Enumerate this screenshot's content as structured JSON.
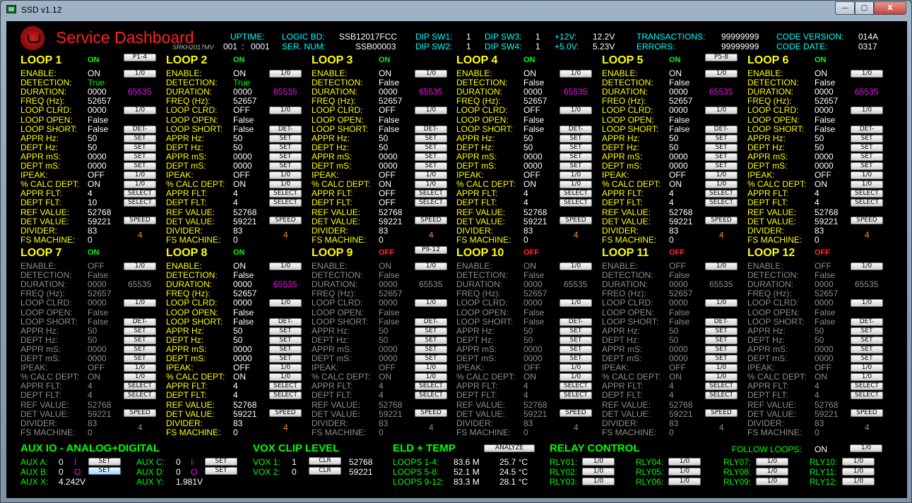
{
  "window": {
    "title": "SSD v1.12",
    "min_glyph": "—",
    "max_glyph": "□",
    "close_glyph": "X"
  },
  "header": {
    "title": "Service Dashboard",
    "subtitle": "SRKH2017MV",
    "uptime_label": "UPTIME:",
    "uptime_day": "001",
    "uptime_sep": ":",
    "uptime_time": "0001",
    "logic_bd_label": "LOGIC BD:",
    "logic_bd": "SSB12017FCC",
    "ser_num_label": "SER. NUM:",
    "ser_num": "SSB00003",
    "dip_sw1_label": "DIP SW1:",
    "dip_sw1": "1",
    "dip_sw2_label": "DIP SW2:",
    "dip_sw2": "1",
    "dip_sw3_label": "DIP SW3:",
    "dip_sw3": "1",
    "dip_sw4_label": "DIP SW4:",
    "dip_sw4": "1",
    "v12_label": "+12V:",
    "v12": "12.2V",
    "v5_label": "+5.0V:",
    "v5": "5.23V",
    "transactions_label": "TRANSACTIONS:",
    "transactions": "99999999",
    "errors_label": "ERRORS:",
    "errors": "99999999",
    "code_version_label": "CODE VERSION:",
    "code_version": "014A",
    "code_date_label": "CODE DATE:",
    "code_date": "0317"
  },
  "row_labels": [
    "ENABLE:",
    "DETECTION:",
    "DURATION:",
    "FREQ (Hz):",
    "LOOP CLRD:",
    "LOOP OPEN:",
    "LOOP SHORT:",
    "APPR Hz:",
    "DEPT Hz:",
    "APPR mS:",
    "DEPT mS:",
    "IPEAK:",
    "% CALC DEPT:",
    "APPR FLT:",
    "DEPT FLT:",
    "REF VALUE:",
    "DET VALUE:",
    "DIVIDER:",
    "FS MACHINE:"
  ],
  "button_labels": {
    "toggle": "1/0",
    "det": "DET-",
    "set": "SET",
    "select": "SELECT",
    "speed": "SPEED"
  },
  "loops": [
    {
      "name": "LOOP 1",
      "status": "ON",
      "active": true,
      "group_button": "P1-4",
      "freq_label": "FREQ (Hz):",
      "enable": "ON",
      "detection": "True",
      "duration": "0000",
      "duration_max": "65535",
      "freq": "52657",
      "loop_clrd": "0000",
      "loop_open": "False",
      "loop_short": "False",
      "appr_hz": "50",
      "dept_hz": "50",
      "appr_ms": "0000",
      "dept_ms": "0000",
      "ipeak": "OFF",
      "calc_dept": "ON",
      "appr_flt": "4",
      "dept_flt": "10",
      "ref_value": "52768",
      "det_value": "59221",
      "divider": "83",
      "fs_machine": "0",
      "speed_value": "4"
    },
    {
      "name": "LOOP 2",
      "status": "ON",
      "active": true,
      "group_button": "",
      "freq_label": "FREQ (Hz):",
      "enable": "ON",
      "detection": "True",
      "duration": "0000",
      "duration_max": "65535",
      "freq": "52657",
      "loop_clrd": "OFF",
      "loop_open": "False",
      "loop_short": "False",
      "appr_hz": "50",
      "dept_hz": "50",
      "appr_ms": "0000",
      "dept_ms": "0000",
      "ipeak": "OFF",
      "calc_dept": "ON",
      "appr_flt": "4",
      "dept_flt": "4",
      "ref_value": "52768",
      "det_value": "59221",
      "divider": "83",
      "fs_machine": "0",
      "speed_value": "4"
    },
    {
      "name": "LOOP 3",
      "status": "ON",
      "active": true,
      "group_button": "",
      "freq_label": "FREQ (Hz):",
      "enable": "ON",
      "detection": "False",
      "duration": "0000",
      "duration_max": "65535",
      "freq": "52657",
      "loop_clrd": "OFF",
      "loop_open": "False",
      "loop_short": "False",
      "appr_hz": "50",
      "dept_hz": "50",
      "appr_ms": "0000",
      "dept_ms": "0000",
      "ipeak": "OFF",
      "calc_dept": "ON",
      "appr_flt": "OFF",
      "dept_flt": "OFF",
      "ref_value": "52768",
      "det_value": "59221",
      "divider": "83",
      "fs_machine": "0",
      "speed_value": "4"
    },
    {
      "name": "LOOP 4",
      "status": "ON",
      "active": true,
      "group_button": "",
      "freq_label": "FREQ (Hz):",
      "enable": "ON",
      "detection": "False",
      "duration": "0000",
      "duration_max": "65535",
      "freq": "52657",
      "loop_clrd": "OFF",
      "loop_open": "False",
      "loop_short": "False",
      "appr_hz": "50",
      "dept_hz": "50",
      "appr_ms": "0000",
      "dept_ms": "0000",
      "ipeak": "OFF",
      "calc_dept": "ON",
      "appr_flt": "4",
      "dept_flt": "4",
      "ref_value": "52768",
      "det_value": "59221",
      "divider": "83",
      "fs_machine": "0",
      "speed_value": "4"
    },
    {
      "name": "LOOP 5",
      "status": "ON",
      "active": true,
      "group_button": "P5-8",
      "freq_label": "FREO (Hz):",
      "enable": "ON",
      "detection": "False",
      "duration": "0000",
      "duration_max": "65535",
      "freq": "52657",
      "loop_clrd": "0000",
      "loop_open": "False",
      "loop_short": "False",
      "appr_hz": "50",
      "dept_hz": "50",
      "appr_ms": "0000",
      "dept_ms": "0000",
      "ipeak": "OFF",
      "calc_dept": "ON",
      "appr_flt": "4",
      "dept_flt": "4",
      "ref_value": "52768",
      "det_value": "59221",
      "divider": "83",
      "fs_machine": "0",
      "speed_value": "4"
    },
    {
      "name": "LOOP 6",
      "status": "ON",
      "active": true,
      "group_button": "",
      "freq_label": "FREQ (Hz):",
      "enable": "ON",
      "detection": "False",
      "duration": "0000",
      "duration_max": "65535",
      "freq": "52657",
      "loop_clrd": "0000",
      "loop_open": "False",
      "loop_short": "False",
      "appr_hz": "50",
      "dept_hz": "50",
      "appr_ms": "0000",
      "dept_ms": "0000",
      "ipeak": "OFF",
      "calc_dept": "ON",
      "appr_flt": "4",
      "dept_flt": "4",
      "ref_value": "52768",
      "det_value": "59221",
      "divider": "83",
      "fs_machine": "0",
      "speed_value": "4"
    },
    {
      "name": "LOOP 7",
      "status": "ON",
      "active": false,
      "group_button": "",
      "freq_label": "FREQ (Hz):",
      "enable": "OFF",
      "detection": "False",
      "duration": "0000",
      "duration_max": "65535",
      "freq": "52657",
      "loop_clrd": "0000",
      "loop_open": "False",
      "loop_short": "False",
      "appr_hz": "50",
      "dept_hz": "50",
      "appr_ms": "0000",
      "dept_ms": "0000",
      "ipeak": "OFF",
      "calc_dept": "ON",
      "appr_flt": "4",
      "dept_flt": "4",
      "ref_value": "52768",
      "det_value": "59221",
      "divider": "83",
      "fs_machine": "0",
      "speed_value": "4"
    },
    {
      "name": "LOOP 8",
      "status": "ON",
      "active": true,
      "group_button": "",
      "freq_label": "FREQ (Hz):",
      "enable": "ON",
      "detection": "False",
      "duration": "0000",
      "duration_max": "65535",
      "freq": "52657",
      "loop_clrd": "0000",
      "loop_open": "False",
      "loop_short": "False",
      "appr_hz": "50",
      "dept_hz": "50",
      "appr_ms": "0000",
      "dept_ms": "0000",
      "ipeak": "OFF",
      "calc_dept": "ON",
      "appr_flt": "4",
      "dept_flt": "4",
      "ref_value": "52768",
      "det_value": "59221",
      "divider": "83",
      "fs_machine": "0",
      "speed_value": "4"
    },
    {
      "name": "LOOP 9",
      "status": "OFF",
      "active": false,
      "group_button": "P9-12",
      "freq_label": "FREQ (Hz):",
      "enable": "ON",
      "detection": "False",
      "duration": "0000",
      "duration_max": "65535",
      "freq": "52657",
      "loop_clrd": "0000",
      "loop_open": "False",
      "loop_short": "False",
      "appr_hz": "50",
      "dept_hz": "50",
      "appr_ms": "0000",
      "dept_ms": "0000",
      "ipeak": "OFF",
      "calc_dept": "ON",
      "appr_flt": "4",
      "dept_flt": "4",
      "ref_value": "52768",
      "det_value": "59221",
      "divider": "83",
      "fs_machine": "0",
      "speed_value": "4"
    },
    {
      "name": "LOOP 10",
      "status": "OFF",
      "active": false,
      "group_button": "",
      "freq_label": "FREQ (Hz):",
      "enable": "ON",
      "detection": "False",
      "duration": "0000",
      "duration_max": "65535",
      "freq": "52657",
      "loop_clrd": "0000",
      "loop_open": "False",
      "loop_short": "False",
      "appr_hz": "50",
      "dept_hz": "50",
      "appr_ms": "0000",
      "dept_ms": "0000",
      "ipeak": "OFF",
      "calc_dept": "ON",
      "appr_flt": "4",
      "dept_flt": "4",
      "ref_value": "52768",
      "det_value": "59221",
      "divider": "83",
      "fs_machine": "0",
      "speed_value": "4"
    },
    {
      "name": "LOOP 11",
      "status": "OFF",
      "active": false,
      "group_button": "",
      "freq_label": "FREO (Hz):",
      "enable": "OFF",
      "detection": "False",
      "duration": "0000",
      "duration_max": "65535",
      "freq": "52657",
      "loop_clrd": "0000",
      "loop_open": "False",
      "loop_short": "False",
      "appr_hz": "50",
      "dept_hz": "50",
      "appr_ms": "0000",
      "dept_ms": "0000",
      "ipeak": "OFF",
      "calc_dept": "ON",
      "appr_flt": "4",
      "dept_flt": "4",
      "ref_value": "52768",
      "det_value": "59221",
      "divider": "83",
      "fs_machine": "0",
      "speed_value": "4"
    },
    {
      "name": "LOOP 12",
      "status": "OFF",
      "active": false,
      "group_button": "",
      "freq_label": "FREQ (Hz):",
      "enable": "OFF",
      "detection": "False",
      "duration": "0000",
      "duration_max": "65535",
      "freq": "52657",
      "loop_clrd": "0000",
      "loop_open": "False",
      "loop_short": "False",
      "appr_hz": "50",
      "dept_hz": "50",
      "appr_ms": "0000",
      "dept_ms": "0000",
      "ipeak": "OFF",
      "calc_dept": "ON",
      "appr_flt": "4",
      "dept_flt": "4",
      "ref_value": "52768",
      "det_value": "59221",
      "divider": "83",
      "fs_machine": "0",
      "speed_value": "4"
    }
  ],
  "aux": {
    "title": "AUX IO - ANALOG+DIGITAL",
    "a_label": "AUX A:",
    "a_value": "0",
    "a_mode": "I",
    "b_label": "AUX B:",
    "b_value": "0",
    "b_mode": "O",
    "x_label": "AUX X:",
    "x_value": "4.242V",
    "c_label": "AUX C:",
    "c_value": "0",
    "c_mode": "I",
    "d_label": "AUX D:",
    "d_value": "0",
    "d_mode": "O",
    "y_label": "AUX Y:",
    "y_value": "1.981V",
    "set_label": "SET"
  },
  "vox": {
    "title": "VOX CLIP LEVEL",
    "vox1_label": "VOX 1:",
    "vox1_value": "1",
    "vox1_level": "52768",
    "vox2_label": "VOX 2:",
    "vox2_value": "0",
    "vox2_level": "59221",
    "clr_label": "CLR"
  },
  "eld": {
    "title": "ELD + TEMP",
    "analyze_label": "ANALYZE",
    "rows": [
      {
        "label": "LOOPS 1-4:",
        "value": "83.6 M",
        "temp": "25.7 °C"
      },
      {
        "label": "LOOPS 5-8:",
        "value": "52.1 M",
        "temp": "24.5 °C"
      },
      {
        "label": "LOOPS 9-12:",
        "value": "83.3 M",
        "temp": "28.1 °C"
      }
    ]
  },
  "relay": {
    "title": "RELAY CONTROL",
    "follow_label": "FOLLOW LOOPS:",
    "follow_value": "ON",
    "toggle_label": "1/0",
    "relays": [
      "RLY01:",
      "RLY02:",
      "RLY03:",
      "RLY04:",
      "RLY05:",
      "RLY06:",
      "RLY07:",
      "RLY08:",
      "RLY09:",
      "RLY10:",
      "RLY11:",
      "RLY12:"
    ]
  },
  "colors": {
    "label": "#ffff00",
    "dim": "#8c8c8c",
    "on": "#00ff00",
    "off": "#ff2a2a",
    "header": "#00ffff",
    "accent": "#ff00ff",
    "speed": "#ff8c1a"
  }
}
